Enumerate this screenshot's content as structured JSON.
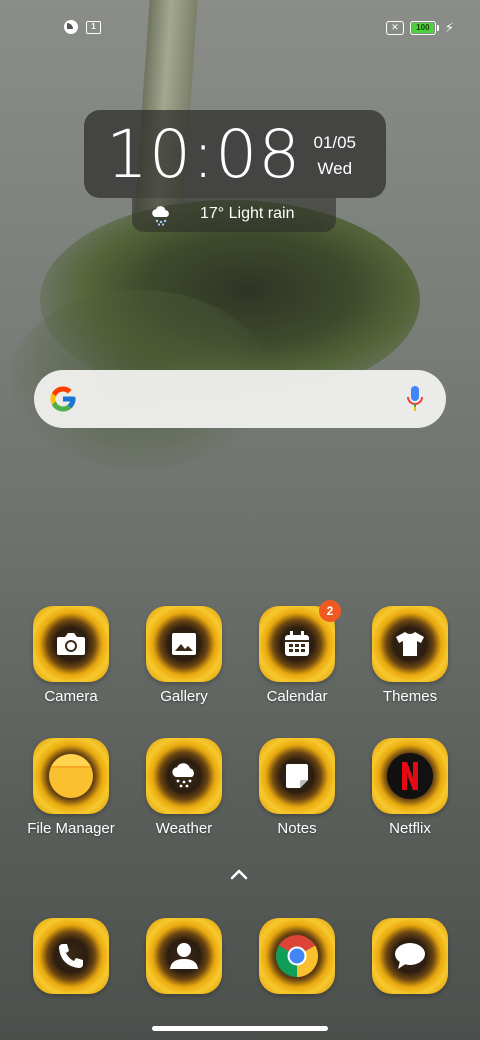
{
  "status_bar": {
    "left_icons": [
      "notification-icon",
      "screen-icon"
    ],
    "screen_icon_text": "1",
    "sim_icon": "sim-off-icon",
    "battery_level": "100",
    "charging": true
  },
  "clock": {
    "time": "10:08",
    "date": "01/05",
    "day": "Wed"
  },
  "weather": {
    "icon": "rain-cloud-icon",
    "text": "17° Light rain"
  },
  "search": {
    "logo": "google-g-icon",
    "mic": "mic-icon"
  },
  "apps": [
    {
      "label": "Camera",
      "icon": "camera-icon"
    },
    {
      "label": "Gallery",
      "icon": "image-icon"
    },
    {
      "label": "Calendar",
      "icon": "calendar-icon",
      "badge": "2"
    },
    {
      "label": "Themes",
      "icon": "tshirt-icon"
    },
    {
      "label": "File Manager",
      "icon": "folder-icon"
    },
    {
      "label": "Weather",
      "icon": "snow-cloud-icon"
    },
    {
      "label": "Notes",
      "icon": "note-icon"
    },
    {
      "label": "Netflix",
      "icon": "netflix-icon"
    }
  ],
  "dock": [
    {
      "icon": "phone-icon"
    },
    {
      "icon": "contacts-icon"
    },
    {
      "icon": "chrome-icon"
    },
    {
      "icon": "messages-icon"
    }
  ],
  "colors": {
    "badge": "#f05a22",
    "battery": "#4fd13d",
    "icon_ring": "#f7c92d"
  }
}
